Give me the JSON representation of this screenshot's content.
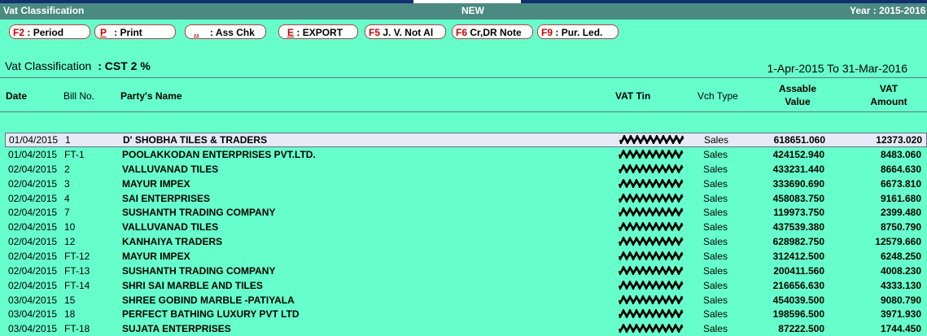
{
  "titlebar": {
    "left": "Vat Classification",
    "center": "NEW",
    "right": "Year : 2015-2016"
  },
  "toolbar": {
    "buttons": [
      {
        "key": "F2",
        "label": ": Period"
      },
      {
        "key": "P",
        "label": ": Print"
      },
      {
        "key": "..",
        "label": ": Ass Chk"
      },
      {
        "key": "E",
        "label": ": EXPORT"
      },
      {
        "key": "F5",
        "label": "J. V. Not Al"
      },
      {
        "key": "F6",
        "label": "Cr,DR Note"
      },
      {
        "key": "F9",
        "label": ": Pur. Led."
      }
    ]
  },
  "filter": {
    "label": "Vat Classification",
    "value": ": CST 2 %",
    "date_range": "1-Apr-2015 To 31-Mar-2016"
  },
  "table": {
    "headers": {
      "date": "Date",
      "bill_no": "Bill No.",
      "party": "Party's Name",
      "vat_tin": "VAT Tin",
      "vch_type": "Vch Type",
      "assable_1": "Assable",
      "assable_2": "Value",
      "vat_1": "VAT",
      "vat_2": "Amount"
    },
    "rows": [
      {
        "date": "01/04/2015",
        "bill": "1",
        "party": "D' SHOBHA TILES & TRADERS",
        "type": "Sales",
        "assable": "618651.060",
        "vat": "12373.020"
      },
      {
        "date": "01/04/2015",
        "bill": "FT-1",
        "party": "POOLAKKODAN ENTERPRISES PVT.LTD.",
        "type": "Sales",
        "assable": "424152.940",
        "vat": "8483.060"
      },
      {
        "date": "02/04/2015",
        "bill": "2",
        "party": "VALLUVANAD TILES",
        "type": "Sales",
        "assable": "433231.440",
        "vat": "8664.630"
      },
      {
        "date": "02/04/2015",
        "bill": "3",
        "party": "MAYUR IMPEX",
        "type": "Sales",
        "assable": "333690.690",
        "vat": "6673.810"
      },
      {
        "date": "02/04/2015",
        "bill": "4",
        "party": "SAI ENTERPRISES",
        "type": "Sales",
        "assable": "458083.750",
        "vat": "9161.680"
      },
      {
        "date": "02/04/2015",
        "bill": "7",
        "party": "SUSHANTH TRADING COMPANY",
        "type": "Sales",
        "assable": "119973.750",
        "vat": "2399.480"
      },
      {
        "date": "02/04/2015",
        "bill": "10",
        "party": "VALLUVANAD TILES",
        "type": "Sales",
        "assable": "437539.380",
        "vat": "8750.790"
      },
      {
        "date": "02/04/2015",
        "bill": "12",
        "party": "KANHAIYA TRADERS",
        "type": "Sales",
        "assable": "628982.750",
        "vat": "12579.660"
      },
      {
        "date": "02/04/2015",
        "bill": "FT-12",
        "party": "MAYUR IMPEX",
        "type": "Sales",
        "assable": "312412.500",
        "vat": "6248.250"
      },
      {
        "date": "02/04/2015",
        "bill": "FT-13",
        "party": "SUSHANTH TRADING COMPANY",
        "type": "Sales",
        "assable": "200411.560",
        "vat": "4008.230"
      },
      {
        "date": "02/04/2015",
        "bill": "FT-14",
        "party": "SHRI SAI MARBLE AND TILES",
        "type": "Sales",
        "assable": "216656.630",
        "vat": "4333.130"
      },
      {
        "date": "03/04/2015",
        "bill": "15",
        "party": "SHREE GOBIND MARBLE -PATIYALA",
        "type": "Sales",
        "assable": "454039.500",
        "vat": "9080.790"
      },
      {
        "date": "03/04/2015",
        "bill": "18",
        "party": "PERFECT BATHING LUXURY PVT LTD",
        "type": "Sales",
        "assable": "198596.500",
        "vat": "3971.930"
      },
      {
        "date": "03/04/2015",
        "bill": "FT-18",
        "party": "SUJATA ENTERPRISES",
        "type": "Sales",
        "assable": "87222.500",
        "vat": "1744.450"
      }
    ]
  }
}
